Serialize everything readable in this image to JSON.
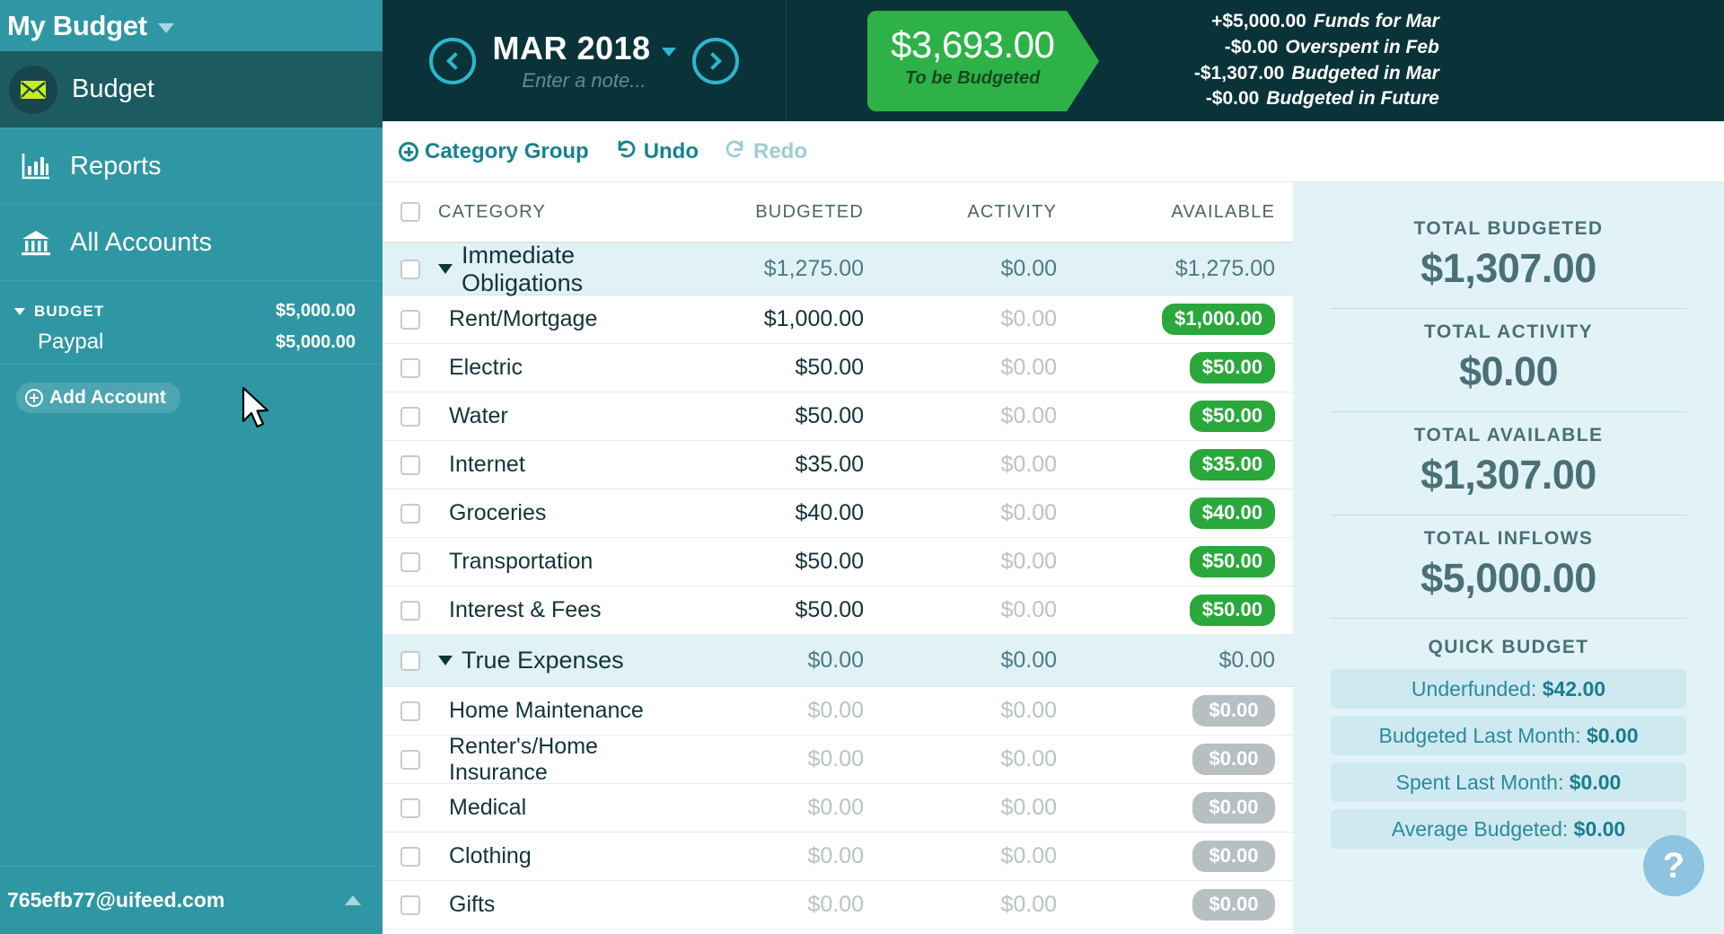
{
  "sidebar": {
    "budget_name": "My Budget",
    "nav": [
      {
        "label": "Budget",
        "icon": "envelope-icon",
        "active": true
      },
      {
        "label": "Reports",
        "icon": "bar-chart-icon",
        "active": false
      },
      {
        "label": "All Accounts",
        "icon": "bank-icon",
        "active": false
      }
    ],
    "account_group": {
      "label": "BUDGET",
      "amount": "$5,000.00"
    },
    "accounts": [
      {
        "name": "Paypal",
        "amount": "$5,000.00"
      }
    ],
    "add_account_label": "Add Account",
    "user_email": "765efb77@uifeed.com"
  },
  "topbar": {
    "month": "MAR 2018",
    "note_placeholder": "Enter a note...",
    "prev_icon": "chevron-left-icon",
    "next_icon": "chevron-right-icon",
    "to_be_budgeted": {
      "amount": "$3,693.00",
      "caption": "To be Budgeted"
    },
    "breakdown": [
      {
        "amount": "+$5,000.00",
        "label": "Funds for Mar"
      },
      {
        "amount": "-$0.00",
        "label": "Overspent in Feb"
      },
      {
        "amount": "-$1,307.00",
        "label": "Budgeted in Mar"
      },
      {
        "amount": "-$0.00",
        "label": "Budgeted in Future"
      }
    ]
  },
  "toolbar": {
    "category_group_label": "Category Group",
    "undo_label": "Undo",
    "redo_label": "Redo"
  },
  "table": {
    "headers": {
      "category": "CATEGORY",
      "budgeted": "BUDGETED",
      "activity": "ACTIVITY",
      "available": "AVAILABLE"
    },
    "rows": [
      {
        "type": "group",
        "name": "Immediate Obligations",
        "budgeted": "$1,275.00",
        "activity": "$0.00",
        "available": "$1,275.00"
      },
      {
        "type": "item",
        "name": "Rent/Mortgage",
        "budgeted": "$1,000.00",
        "activity": "$0.00",
        "available": "$1,000.00",
        "pill": "green"
      },
      {
        "type": "item",
        "name": "Electric",
        "budgeted": "$50.00",
        "activity": "$0.00",
        "available": "$50.00",
        "pill": "green"
      },
      {
        "type": "item",
        "name": "Water",
        "budgeted": "$50.00",
        "activity": "$0.00",
        "available": "$50.00",
        "pill": "green"
      },
      {
        "type": "item",
        "name": "Internet",
        "budgeted": "$35.00",
        "activity": "$0.00",
        "available": "$35.00",
        "pill": "green"
      },
      {
        "type": "item",
        "name": "Groceries",
        "budgeted": "$40.00",
        "activity": "$0.00",
        "available": "$40.00",
        "pill": "green"
      },
      {
        "type": "item",
        "name": "Transportation",
        "budgeted": "$50.00",
        "activity": "$0.00",
        "available": "$50.00",
        "pill": "green"
      },
      {
        "type": "item",
        "name": "Interest & Fees",
        "budgeted": "$50.00",
        "activity": "$0.00",
        "available": "$50.00",
        "pill": "green"
      },
      {
        "type": "group",
        "name": "True Expenses",
        "budgeted": "$0.00",
        "activity": "$0.00",
        "available": "$0.00"
      },
      {
        "type": "item",
        "name": "Home Maintenance",
        "budgeted": "$0.00",
        "activity": "$0.00",
        "available": "$0.00",
        "pill": "gray",
        "muted": true
      },
      {
        "type": "item",
        "name": "Renter's/Home Insurance",
        "budgeted": "$0.00",
        "activity": "$0.00",
        "available": "$0.00",
        "pill": "gray",
        "muted": true
      },
      {
        "type": "item",
        "name": "Medical",
        "budgeted": "$0.00",
        "activity": "$0.00",
        "available": "$0.00",
        "pill": "gray",
        "muted": true
      },
      {
        "type": "item",
        "name": "Clothing",
        "budgeted": "$0.00",
        "activity": "$0.00",
        "available": "$0.00",
        "pill": "gray",
        "muted": true
      },
      {
        "type": "item",
        "name": "Gifts",
        "budgeted": "$0.00",
        "activity": "$0.00",
        "available": "$0.00",
        "pill": "gray",
        "muted": true
      }
    ]
  },
  "summary": {
    "totals": [
      {
        "label": "TOTAL BUDGETED",
        "value": "$1,307.00"
      },
      {
        "label": "TOTAL ACTIVITY",
        "value": "$0.00"
      },
      {
        "label": "TOTAL AVAILABLE",
        "value": "$1,307.00"
      },
      {
        "label": "TOTAL INFLOWS",
        "value": "$5,000.00"
      }
    ],
    "quick_budget_title": "QUICK BUDGET",
    "quick_budget": [
      {
        "label": "Underfunded:",
        "value": "$42.00"
      },
      {
        "label": "Budgeted Last Month:",
        "value": "$0.00"
      },
      {
        "label": "Spent Last Month:",
        "value": "$0.00"
      },
      {
        "label": "Average Budgeted:",
        "value": "$0.00"
      }
    ],
    "help_label": "?"
  },
  "colors": {
    "sidebar_teal": "#2f97a4",
    "sidebar_active": "#1d5b63",
    "topbar_dark": "#0a3339",
    "accent_green": "#2eb248",
    "pill_green": "#2aa83b",
    "pill_gray": "#b8bfc2",
    "panel_blue": "#e2f3f8",
    "link_teal": "#16838f"
  }
}
